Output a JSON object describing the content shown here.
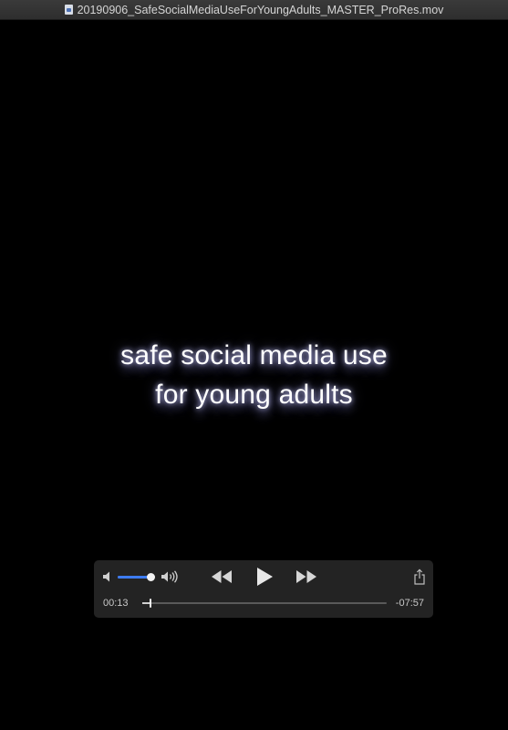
{
  "window": {
    "title": "20190906_SafeSocialMediaUseForYoungAdults_MASTER_ProRes.mov",
    "title_icon": "quicktime-document-icon"
  },
  "video": {
    "caption_lines": [
      "safe social media use",
      "for young adults"
    ]
  },
  "controller": {
    "volume_level": 0.9,
    "elapsed": "00:13",
    "remaining": "-07:57",
    "progress": 0.03,
    "icons": {
      "volume_min": "speaker-low-icon",
      "volume_max": "speaker-high-icon",
      "rewind": "rewind-icon",
      "play": "play-icon",
      "fast_forward": "fast-forward-icon",
      "share": "share-icon"
    },
    "accent_color": "#3d7bf0"
  }
}
